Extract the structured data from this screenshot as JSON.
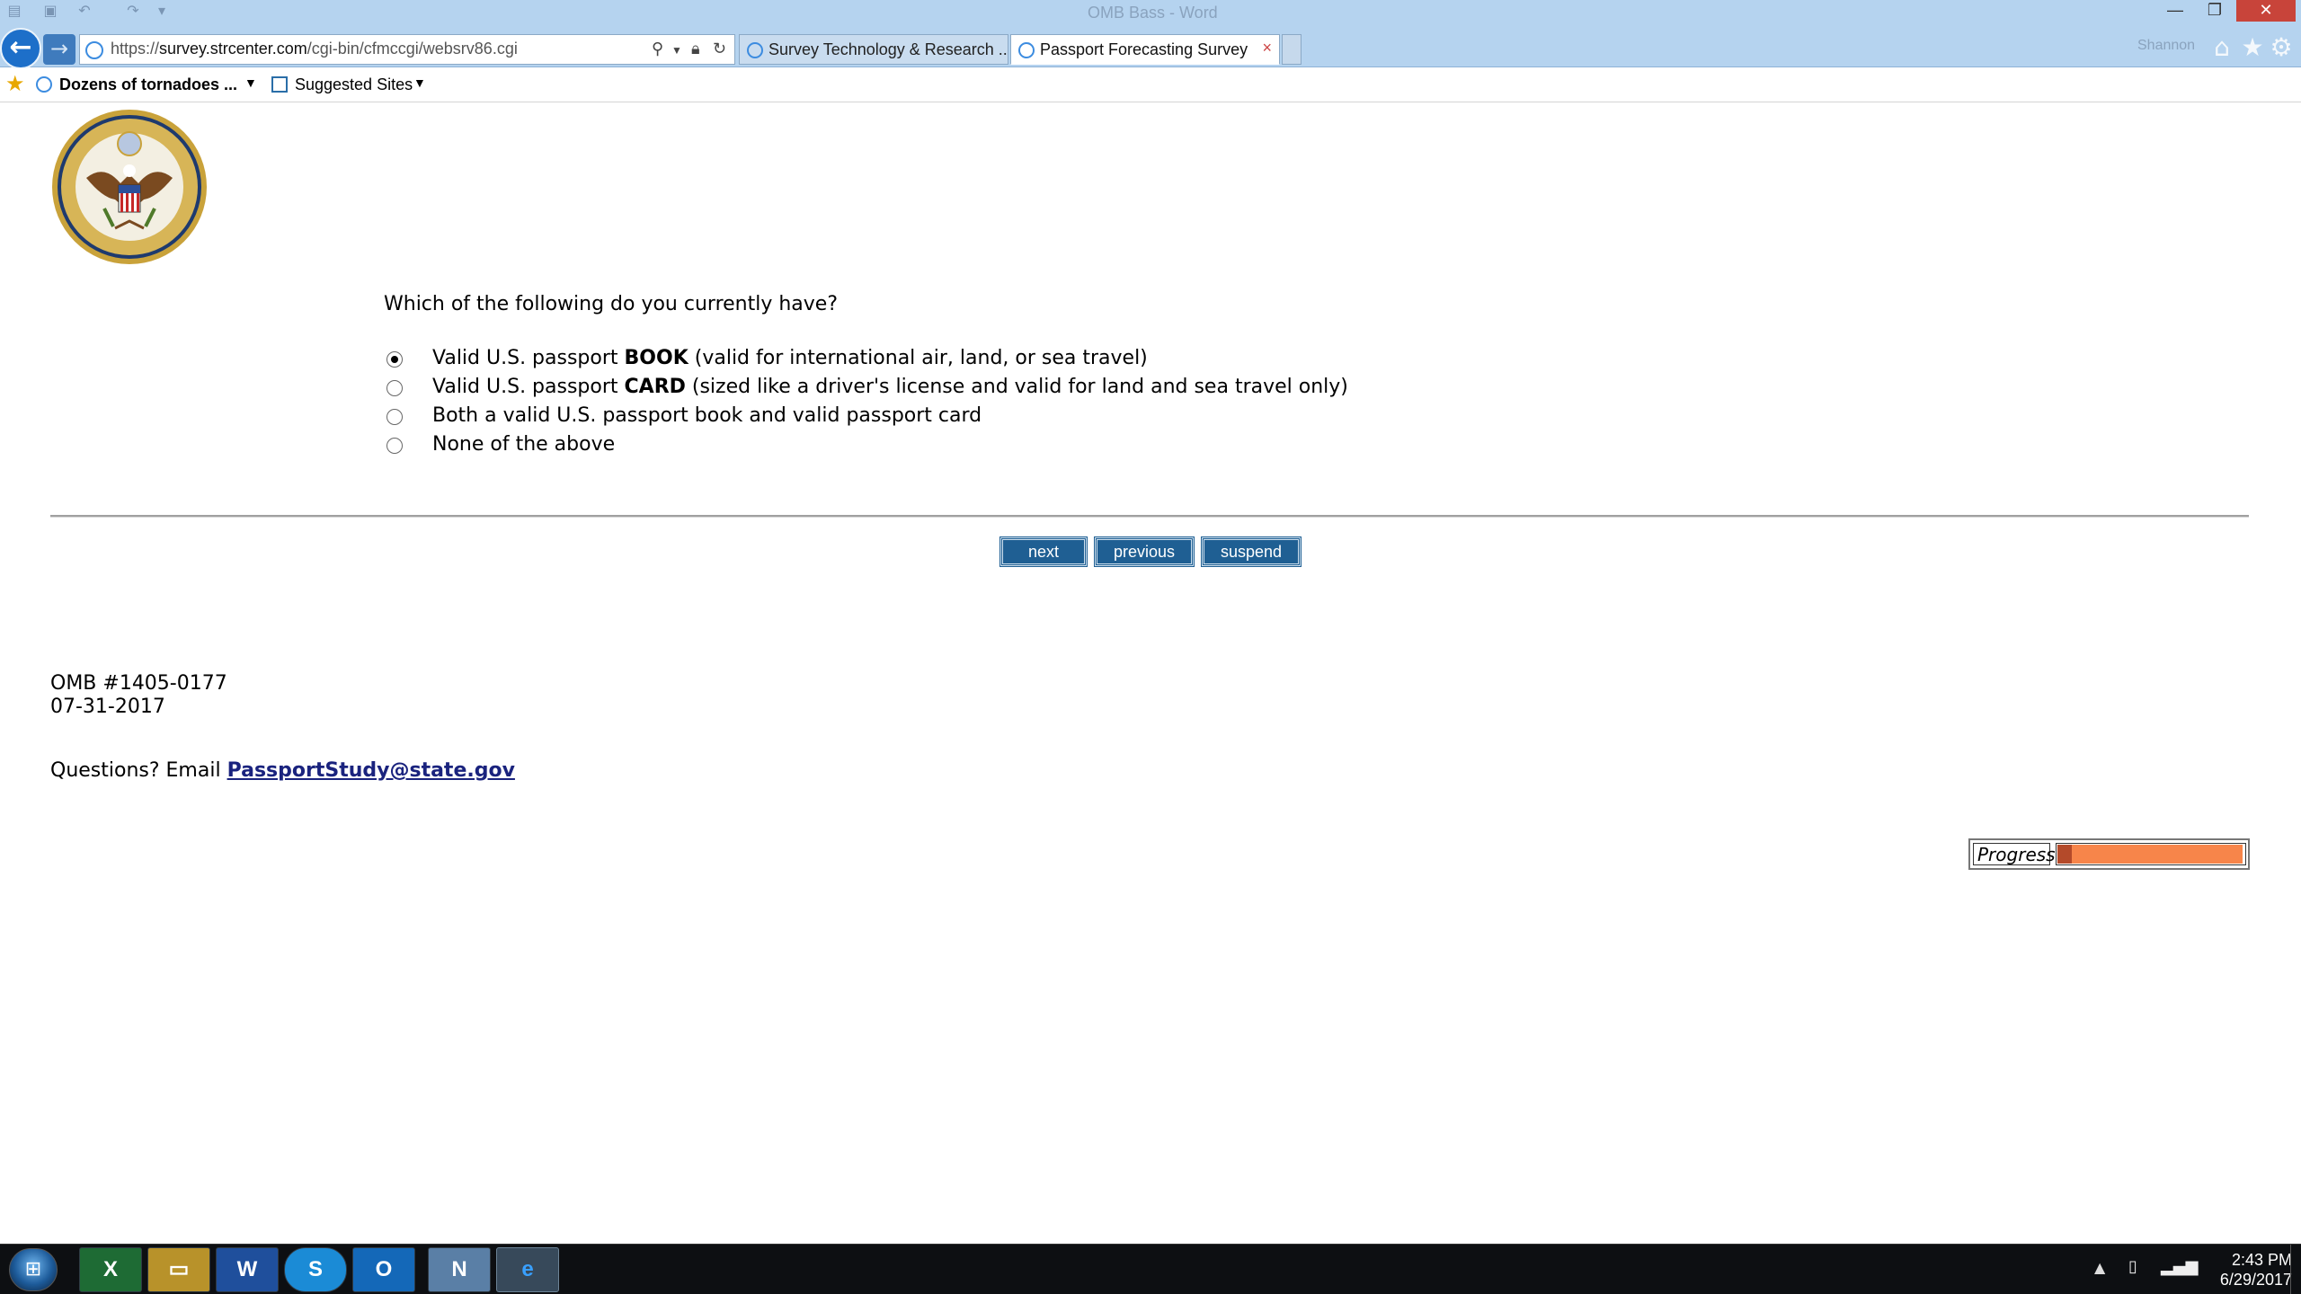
{
  "browser": {
    "window_title": "OMB Bass - Word",
    "address": {
      "scheme": "https://",
      "host": "survey.strcenter.com",
      "path": "/cgi-bin/cfmccgi/websrv86.cgi"
    },
    "tabs": [
      {
        "label": "Survey Technology & Research ...",
        "active": false
      },
      {
        "label": "Passport Forecasting Survey",
        "active": true
      }
    ],
    "tab_close": "×",
    "user_name": "Shannon",
    "favorites": {
      "item1": "Dozens of tornadoes ...",
      "item2": "Suggested Sites"
    },
    "toolbar_icons": [
      "home-icon",
      "favorites-star-icon",
      "tools-gear-icon"
    ]
  },
  "survey": {
    "question": "Which of the following do you currently have?",
    "options": [
      {
        "pre": "Valid U.S. passport ",
        "bold": "BOOK",
        "post": " (valid for international air, land, or sea travel)",
        "selected": true
      },
      {
        "pre": "Valid U.S. passport ",
        "bold": "CARD",
        "post": " (sized like a driver's license and valid for land and sea travel only)",
        "selected": false
      },
      {
        "pre": "Both a valid U.S. passport book and valid passport card",
        "bold": "",
        "post": "",
        "selected": false
      },
      {
        "pre": "None of the above",
        "bold": "",
        "post": "",
        "selected": false
      }
    ],
    "buttons": {
      "next": "next",
      "previous": "previous",
      "suspend": "suspend"
    },
    "omb_number": "OMB #1405-0177",
    "omb_date": "07-31-2017",
    "questions_prefix": "Questions? Email ",
    "contact_email": "PassportStudy@state.gov",
    "progress_label": "Progress",
    "progress_fraction": 0.99,
    "progress_color": "#f7854a"
  },
  "taskbar": {
    "apps": [
      "Excel",
      "File Explorer",
      "Word",
      "Skype",
      "Outlook",
      "Nvivo",
      "Internet Explorer"
    ],
    "active_app": "Internet Explorer",
    "time": "2:43 PM",
    "date": "6/29/2017"
  }
}
